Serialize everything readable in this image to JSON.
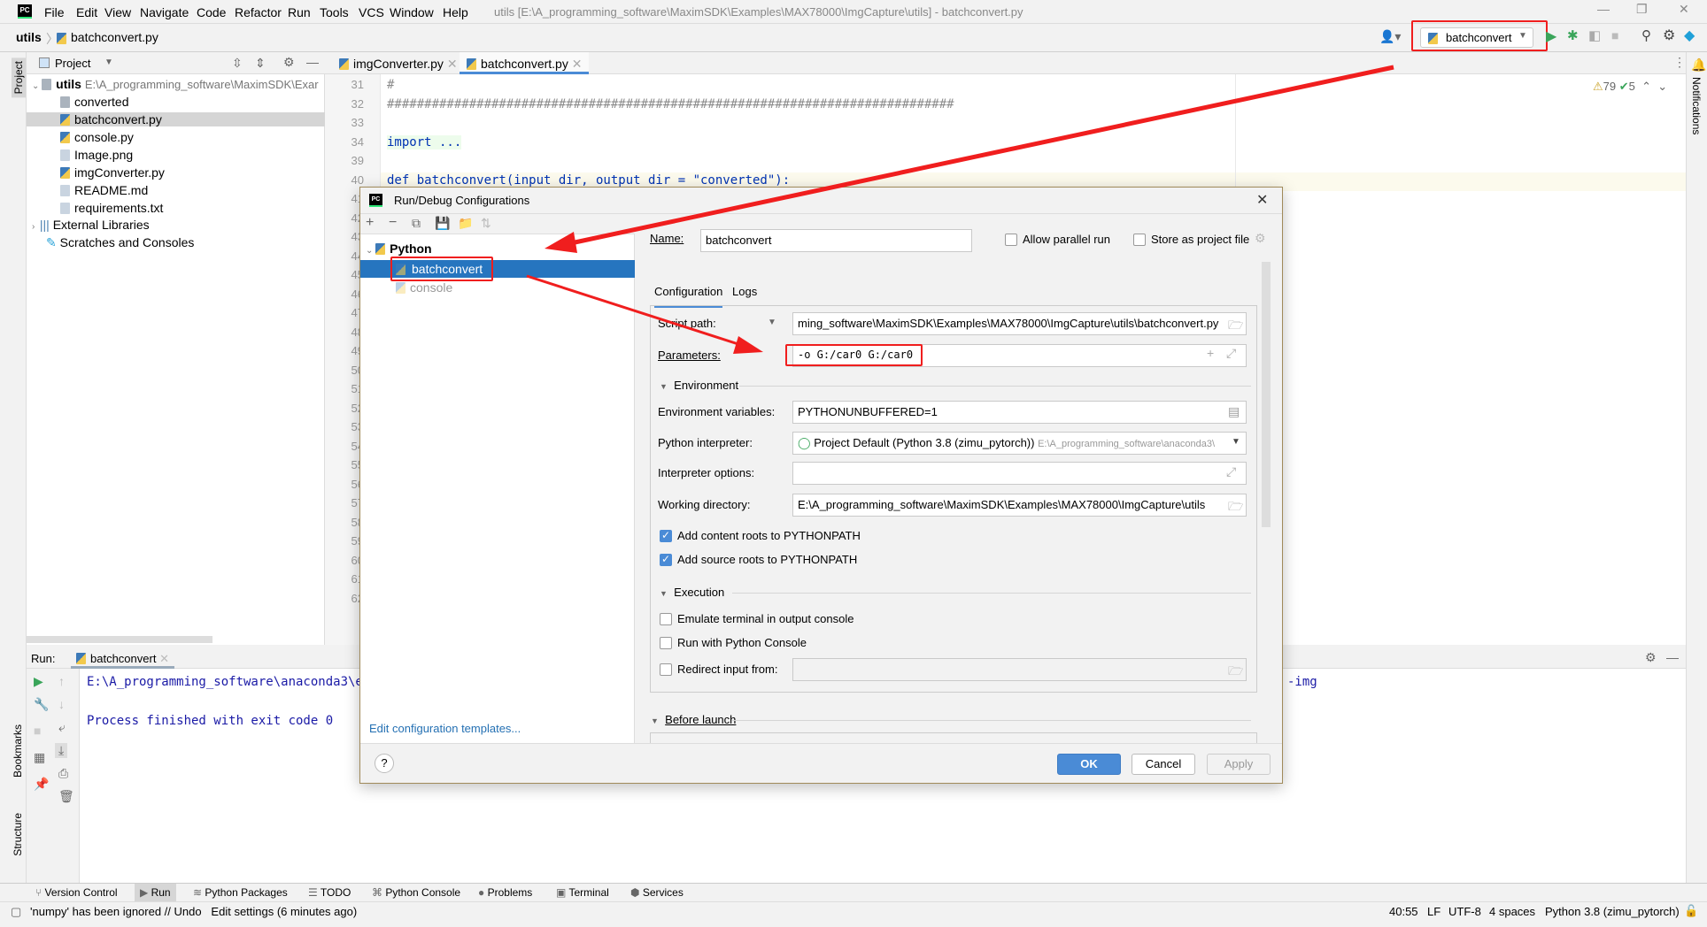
{
  "window": {
    "title": "utils [E:\\A_programming_software\\MaximSDK\\Examples\\MAX78000\\ImgCapture\\utils] - batchconvert.py"
  },
  "menu": [
    "File",
    "Edit",
    "View",
    "Navigate",
    "Code",
    "Refactor",
    "Run",
    "Tools",
    "VCS",
    "Window",
    "Help"
  ],
  "breadcrumb": {
    "root": "utils",
    "file": "batchconvert.py"
  },
  "toolbar": {
    "run_config": "batchconvert"
  },
  "left_stripe": {
    "project": "Project",
    "bookmarks": "Bookmarks",
    "structure": "Structure"
  },
  "right_stripe": {
    "notifications": "Notifications"
  },
  "project": {
    "title": "Project",
    "root": "utils",
    "root_path": "E:\\A_programming_software\\MaximSDK\\Exar",
    "items": [
      "converted",
      "batchconvert.py",
      "console.py",
      "Image.png",
      "imgConverter.py",
      "README.md",
      "requirements.txt"
    ],
    "external": "External Libraries",
    "scratches": "Scratches and Consoles"
  },
  "editor": {
    "tabs": [
      "imgConverter.py",
      "batchconvert.py"
    ],
    "warnings": "79",
    "weak": "5",
    "lines": [
      {
        "n": "31",
        "t": "#"
      },
      {
        "n": "32",
        "t": "############################################################################"
      },
      {
        "n": "33",
        "t": ""
      },
      {
        "n": "34",
        "t": "import ..."
      },
      {
        "n": "39",
        "t": ""
      },
      {
        "n": "40",
        "t": "def batchconvert(input_dir, output_dir = \"converted\"):"
      },
      {
        "n": "41",
        "t": ""
      },
      {
        "n": "42",
        "t": ""
      },
      {
        "n": "43",
        "t": ""
      },
      {
        "n": "44",
        "t": ""
      },
      {
        "n": "45",
        "t": ""
      },
      {
        "n": "46",
        "t": ""
      },
      {
        "n": "47",
        "t": ""
      },
      {
        "n": "48",
        "t": ""
      },
      {
        "n": "49",
        "t": ""
      },
      {
        "n": "50",
        "t": ""
      },
      {
        "n": "51",
        "t": ""
      },
      {
        "n": "52",
        "t": ""
      },
      {
        "n": "53",
        "t": ""
      },
      {
        "n": "54",
        "t": ""
      },
      {
        "n": "55",
        "t": ""
      },
      {
        "n": "56",
        "t": ""
      },
      {
        "n": "57",
        "t": ""
      },
      {
        "n": "58",
        "t": ""
      },
      {
        "n": "59",
        "t": ""
      },
      {
        "n": "60",
        "t": ""
      },
      {
        "n": "61",
        "t": ""
      },
      {
        "n": "62",
        "t": ""
      }
    ]
  },
  "run": {
    "label": "Run:",
    "tab": "batchconvert",
    "line1": "E:\\A_programming_software\\anaconda3\\en",
    "line1_tail": "-img",
    "line2": "Process finished with exit code 0"
  },
  "bottom_tabs": [
    "Version Control",
    "Run",
    "Python Packages",
    "TODO",
    "Python Console",
    "Problems",
    "Terminal",
    "Services"
  ],
  "status": {
    "message": "'numpy' has been ignored // Undo   Edit settings (6 minutes ago)",
    "position": "40:55",
    "line_sep": "LF",
    "encoding": "UTF-8",
    "indent": "4 spaces",
    "interpreter": "Python 3.8 (zimu_pytorch)"
  },
  "dialog": {
    "title": "Run/Debug Configurations",
    "tree_group": "Python",
    "tree_items": [
      "batchconvert",
      "console"
    ],
    "edit_templates": "Edit configuration templates...",
    "name_label": "Name:",
    "name_value": "batchconvert",
    "allow_parallel": "Allow parallel run",
    "store_project": "Store as project file",
    "tabs": [
      "Configuration",
      "Logs"
    ],
    "script_path_label": "Script path:",
    "script_path": "ming_software\\MaximSDK\\Examples\\MAX78000\\ImgCapture\\utils\\batchconvert.py",
    "parameters_label": "Parameters:",
    "parameters": "-o G:/car0 G:/car0",
    "environment": "Environment",
    "env_vars_label": "Environment variables:",
    "env_vars": "PYTHONUNBUFFERED=1",
    "interpreter_label": "Python interpreter:",
    "interpreter": "Project Default (Python 3.8 (zimu_pytorch))",
    "interpreter_path": "E:\\A_programming_software\\anaconda3\\",
    "interp_options_label": "Interpreter options:",
    "interp_options": "",
    "workdir_label": "Working directory:",
    "workdir": "E:\\A_programming_software\\MaximSDK\\Examples\\MAX78000\\ImgCapture\\utils",
    "add_content": "Add content roots to PYTHONPATH",
    "add_source": "Add source roots to PYTHONPATH",
    "execution": "Execution",
    "emulate": "Emulate terminal in output console",
    "run_console": "Run with Python Console",
    "redirect": "Redirect input from:",
    "before_launch": "Before launch",
    "help": "?",
    "ok": "OK",
    "cancel": "Cancel",
    "apply": "Apply",
    "checks": {
      "allow_parallel": false,
      "store_project": false,
      "add_content": true,
      "add_source": true,
      "emulate": false,
      "run_console": false,
      "redirect": false
    }
  },
  "colors": {
    "selection": "#2675bf",
    "accent": "#4a8bd6",
    "annotation": "#f01e1e",
    "console_text": "#1a1aa6"
  }
}
